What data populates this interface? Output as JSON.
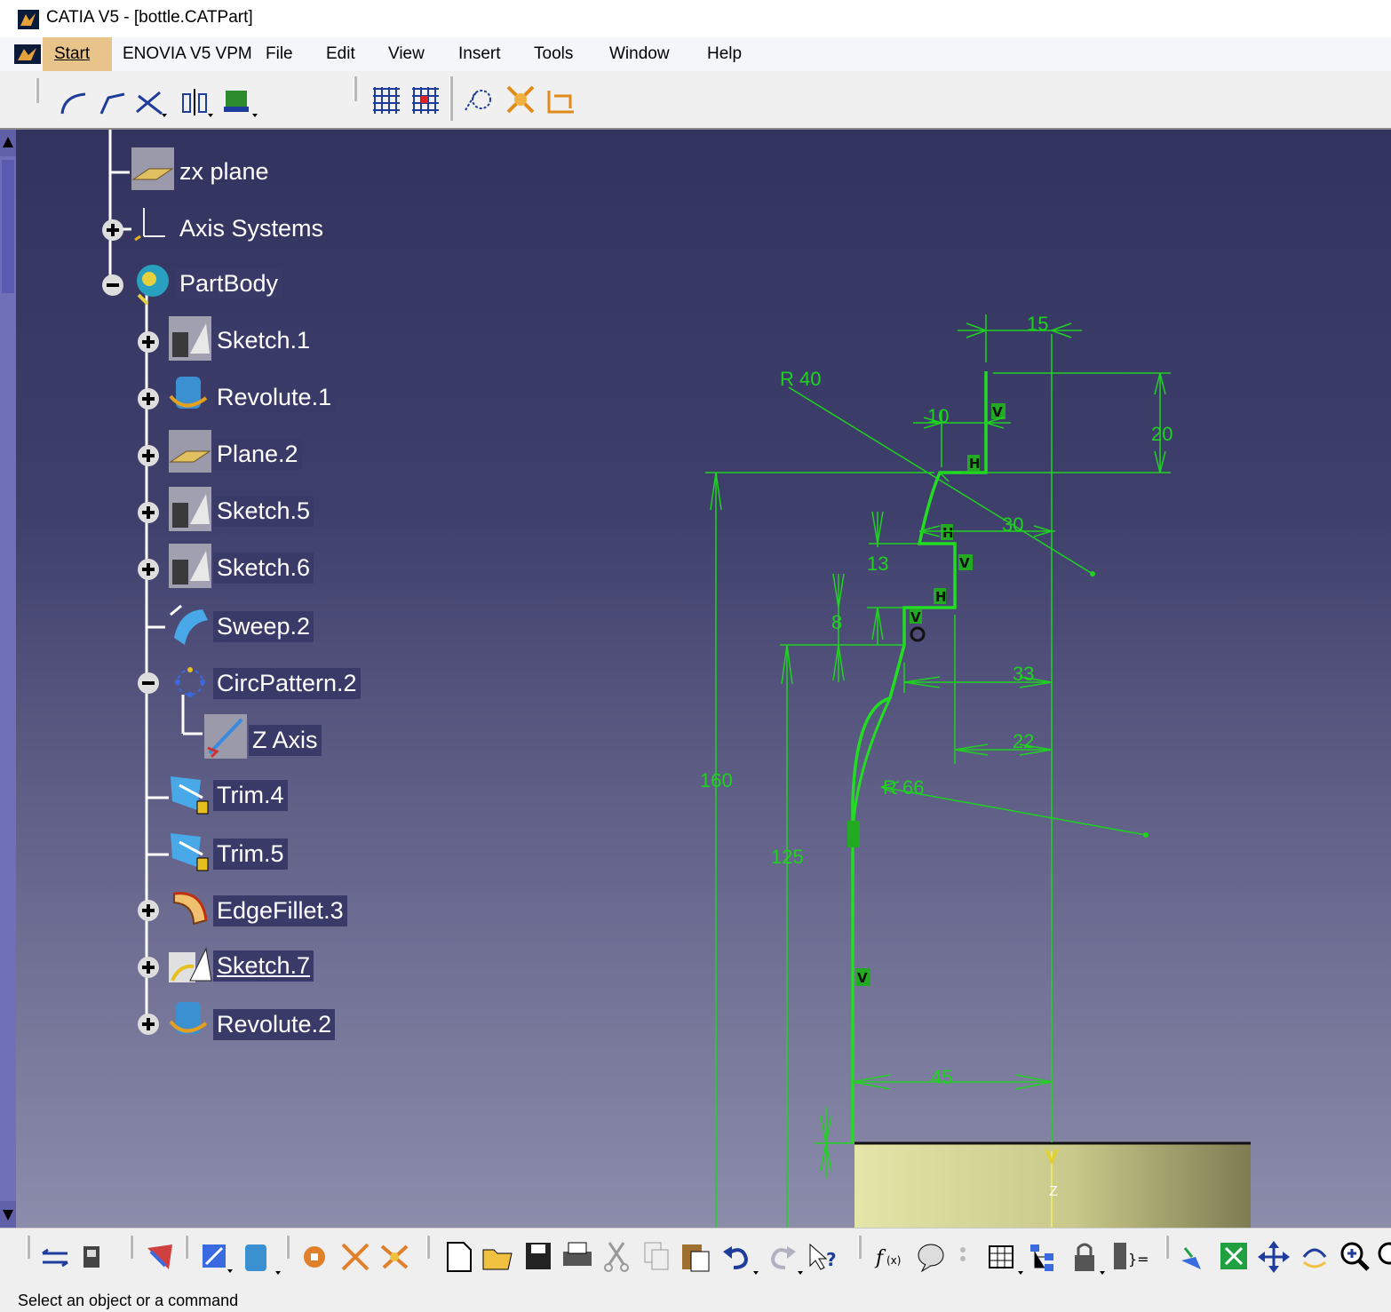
{
  "window": {
    "title": "CATIA V5 - [bottle.CATPart]"
  },
  "menubar": {
    "items": [
      {
        "label": "Start"
      },
      {
        "label": "ENOVIA V5 VPM"
      },
      {
        "label": "File"
      },
      {
        "label": "Edit"
      },
      {
        "label": "View"
      },
      {
        "label": "Insert"
      },
      {
        "label": "Tools"
      },
      {
        "label": "Window"
      },
      {
        "label": "Help"
      }
    ]
  },
  "tree": {
    "nodes": [
      {
        "label": "zx plane"
      },
      {
        "label": "Axis Systems"
      },
      {
        "label": "PartBody"
      },
      {
        "label": "Sketch.1"
      },
      {
        "label": "Revolute.1"
      },
      {
        "label": "Plane.2"
      },
      {
        "label": "Sketch.5"
      },
      {
        "label": "Sketch.6"
      },
      {
        "label": "Sweep.2"
      },
      {
        "label": "CircPattern.2"
      },
      {
        "label": "Z Axis"
      },
      {
        "label": "Trim.4"
      },
      {
        "label": "Trim.5"
      },
      {
        "label": "EdgeFillet.3"
      },
      {
        "label": "Sketch.7"
      },
      {
        "label": "Revolute.2"
      }
    ]
  },
  "sketch": {
    "dimensions": {
      "d15": "15",
      "r40": "R 40",
      "d10": "10",
      "d20": "20",
      "d30": "30",
      "d13": "13",
      "d8": "8",
      "d33": "33",
      "d22": "22",
      "d160": "160",
      "r66": "R 66",
      "d125": "125",
      "d45": "45"
    },
    "constraints": {
      "h": "H",
      "v": "V",
      "o": "O"
    },
    "axis_label": "Z",
    "colors": {
      "geometry": "#22dd22",
      "dimension": "#1fd21f",
      "part": "#e2e4a6"
    }
  },
  "statusbar": {
    "text": "Select an object or a command"
  }
}
